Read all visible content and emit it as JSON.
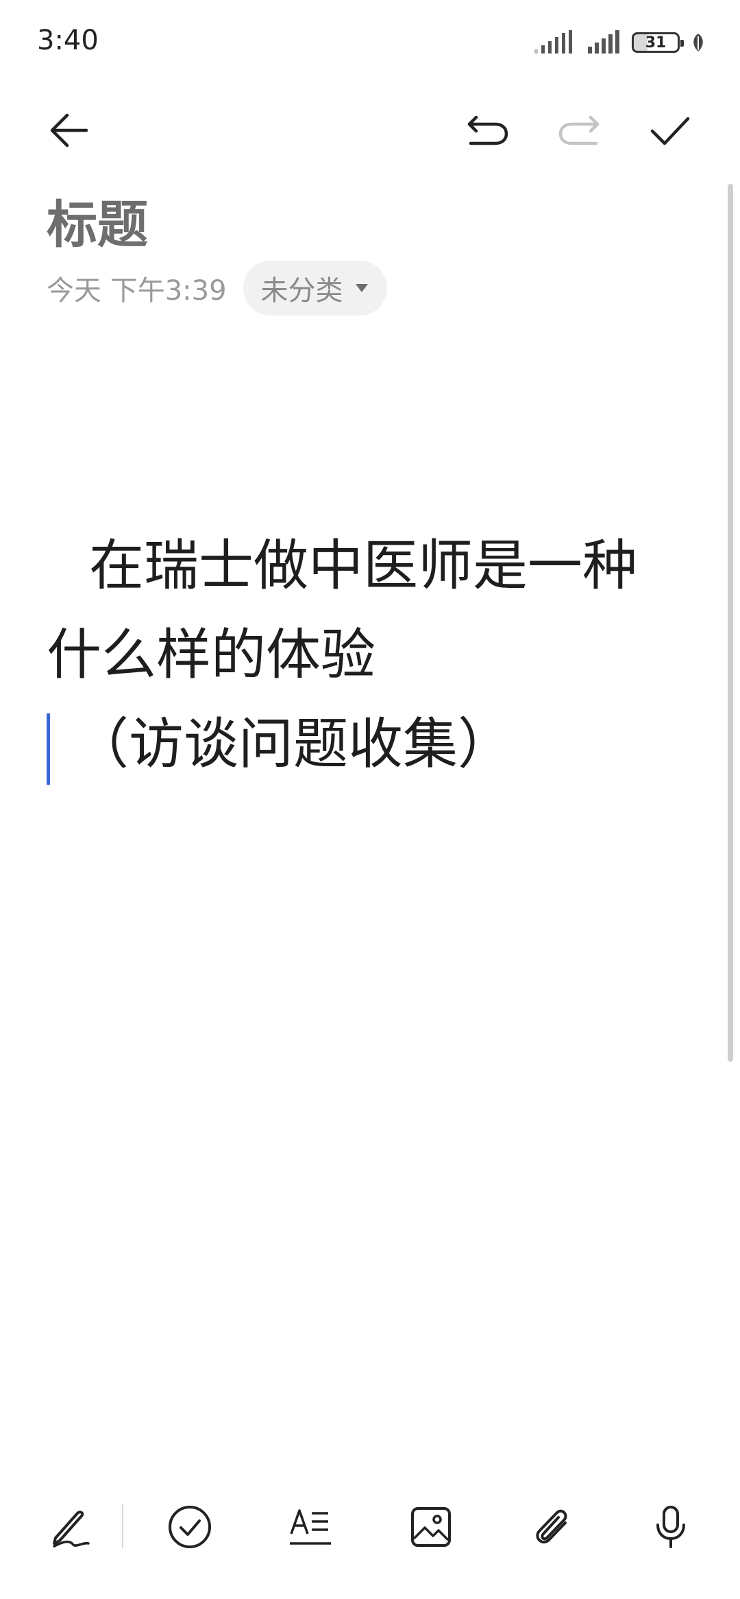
{
  "status_bar": {
    "time": "3:40",
    "battery_level": "31",
    "icons": [
      "signal-weak-icon",
      "signal-icon",
      "battery-icon",
      "leaf-icon"
    ]
  },
  "toolbar": {
    "icons": [
      "back-arrow-icon",
      "undo-icon",
      "redo-icon",
      "checkmark-icon"
    ]
  },
  "note": {
    "title": "标题",
    "date": "今天 下午3:39",
    "category": "未分类",
    "body_lines": [
      "在瑞士做中医师是一种",
      "什么样的体验",
      "（访谈问题收集）"
    ]
  },
  "bottom_toolbar": {
    "icons": [
      "pen-icon",
      "check-circle-icon",
      "text-format-icon",
      "image-icon",
      "attachment-icon",
      "microphone-icon"
    ]
  },
  "colors": {
    "accent": "#3a66d6",
    "title": "#6e6e6e",
    "meta": "#9a9a9a",
    "chip_bg": "#f1f1f1"
  }
}
